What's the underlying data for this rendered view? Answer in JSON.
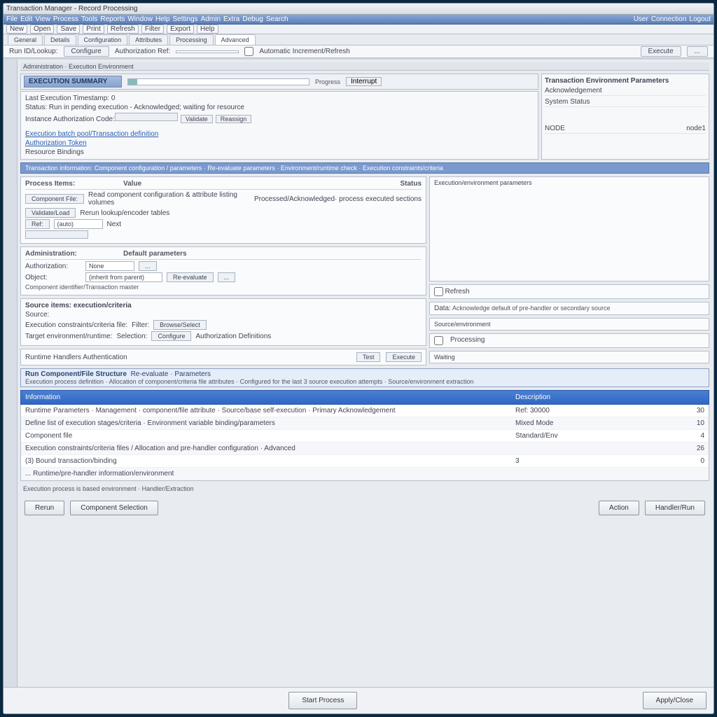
{
  "title": "Transaction Manager - Record Processing",
  "menu": {
    "items": [
      "File",
      "Edit",
      "View",
      "Process",
      "Tools",
      "Reports",
      "Window",
      "Help",
      "Settings",
      "Admin",
      "Extra",
      "Debug",
      "Search"
    ],
    "right": [
      "User",
      "Connection",
      "Logout"
    ]
  },
  "toolbar": {
    "items": [
      "New",
      "Open",
      "Save",
      "Print",
      "Refresh",
      "Filter",
      "Export",
      "Help"
    ]
  },
  "tabs": {
    "items": [
      "General",
      "Details",
      "Configuration",
      "Attributes",
      "Processing",
      "Advanced"
    ],
    "active": 5
  },
  "params": {
    "label1": "Run ID/Lookup:",
    "btn1": "Configure",
    "label2": "Authorization Ref:",
    "cb": "Automatic Increment/Refresh",
    "btn2": "Execute",
    "btn3": "..."
  },
  "crumb": "Administration · Execution Environment",
  "bluehdr": "EXECUTION SUMMARY",
  "progress": {
    "label": "Progress",
    "btn": "Interrupt"
  },
  "info": {
    "l1": "Last Execution Timestamp: 0",
    "l2": "Status: Run in pending execution - Acknowledged; waiting for resource",
    "l3a": "Instance Authorization Code:",
    "btn1": "Validate",
    "btn2": "Reassign",
    "l4": "Execution batch pool/Transaction definition",
    "l5": "Authorization Token",
    "link": true,
    "l6": "Resource Bindings"
  },
  "rightinfo": {
    "h": "Transaction Environment Parameters",
    "r1": "Acknowledgement",
    "r2": "System Status",
    "r3k": "NODE",
    "r3v": "node1"
  },
  "sectionbar": "Transaction information: Component configuration / parameters · Re-evaluate parameters · Environment/runtime check · Execution constraints/criteria",
  "mid": {
    "panel1": {
      "h1": "Process Items:",
      "h1b": "Value",
      "h2": "Status",
      "r1btn": "Component File:",
      "r1txt": "Read component configuration & attribute listing volumes",
      "r1st": "Processed/Acknowledged· process executed sections",
      "r2btn": "Validate/Load",
      "r2txt": "Rerun lookup/encoder tables",
      "r3btn": "Ref:",
      "r3inp": "(auto)",
      "r3txt": "Next"
    },
    "panel2": {
      "h": "Administration:",
      "hb": "Default parameters",
      "r1a": "Authorization:",
      "r1b": "None",
      "r1c": "...",
      "r2a": "Object:",
      "r2b": "(inherit from parent)",
      "r2c": "Re-evaluate",
      "r2d": "...",
      "l": "Component identifier/Transaction master"
    },
    "panel3": {
      "h": "Source items: execution/criteria",
      "r1": "Source:",
      "r2a": "Execution constraints/criteria file:",
      "r2b": "Filter:",
      "r2btn": "Browse/Select",
      "r3a": "Target environment/runtime:",
      "r3b": "Selection:",
      "r3btn": "Configure",
      "r3txt": "Authorization Definitions"
    },
    "panel4": {
      "h": "Runtime Handlers Authentication",
      "btn1": "Test",
      "btn2": "Execute"
    },
    "right": {
      "r1": "Execution/environment parameters",
      "r2a": "Refresh",
      "r2b": "",
      "r3a": "Data:",
      "r3b": "Acknowledge default of pre-handler or secondary source",
      "r4": "Source/environment",
      "r5": "Processing",
      "r6": "Waiting"
    }
  },
  "banner": {
    "l1a": "Run Component/File Structure",
    "l1b": "Re-evaluate · Parameters",
    "l2": "Execution process definition · Allocation of component/criteria file attributes · Configured for the last 3 source execution attempts · Source/environment extraction"
  },
  "table": {
    "h1": "Information",
    "h2": "Description",
    "h3": "",
    "rows": [
      {
        "c1": "Runtime Parameters · Management · component/file attribute · Source/base self-execution · Primary Acknowledgement",
        "c2": "Ref: 30000",
        "c3": "30"
      },
      {
        "c1": "Define list of execution stages/criteria · Environment variable binding/parameters",
        "c2": "Mixed Mode",
        "c3": "10"
      },
      {
        "c1": "Component file",
        "c2": "Standard/Env",
        "c3": "4"
      },
      {
        "c1": "Execution constraints/criteria files / Allocation and pre-handler configuration · Advanced",
        "c2": "",
        "c3": "26"
      },
      {
        "c1": "(3) Bound transaction/binding",
        "c2": "3",
        "c3": "0"
      },
      {
        "c1": "... Runtime/pre-handler information/environment",
        "c2": "",
        "c3": ""
      }
    ]
  },
  "note": "Execution process is based environment · Handler/Extraction",
  "buttons": {
    "b1": "Rerun",
    "b2": "Component Selection",
    "b3": "Action",
    "b4": "Handler/Run"
  },
  "footer": {
    "b1": "Start Process",
    "b2": "Apply/Close"
  }
}
